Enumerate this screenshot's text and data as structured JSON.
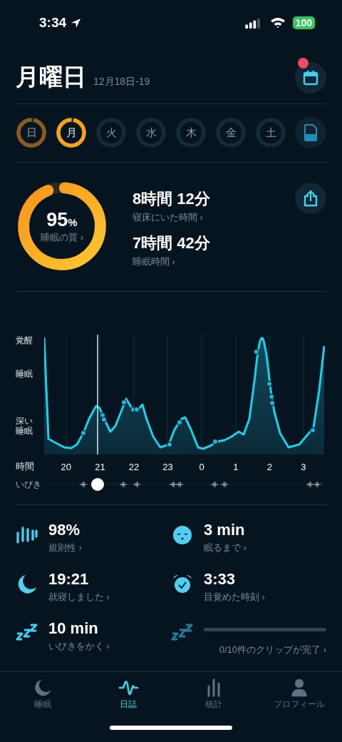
{
  "status_bar": {
    "time": "3:34",
    "battery": "100"
  },
  "header": {
    "title": "月曜日",
    "date": "12月18日-19",
    "notification": true
  },
  "days": [
    {
      "label": "日",
      "kind": "day",
      "level": 0.97,
      "selected": false
    },
    {
      "label": "月",
      "kind": "day",
      "level": 0.97,
      "selected": true
    },
    {
      "label": "火",
      "kind": "day",
      "selected": false
    },
    {
      "label": "水",
      "kind": "day",
      "selected": false
    },
    {
      "label": "木",
      "kind": "day",
      "selected": false
    },
    {
      "label": "金",
      "kind": "day",
      "selected": false
    },
    {
      "label": "土",
      "kind": "day",
      "selected": false
    },
    {
      "kind": "report"
    }
  ],
  "quality": {
    "value": "95",
    "unit": "%",
    "label": "睡眠の質 ›",
    "level": 0.95
  },
  "durations": [
    {
      "value": "8時間 12分",
      "label": "寝床にいた時間 ›"
    },
    {
      "value": "7時間 42分",
      "label": "睡眠時間 ›"
    }
  ],
  "graph": {
    "y_labels": [
      "覚醒",
      "睡眠",
      "深い睡眠"
    ],
    "x_title": "時間",
    "x_labels": [
      "20",
      "21",
      "22",
      "23",
      "0",
      "1",
      "2",
      "3"
    ],
    "snore_label": "いびき"
  },
  "metrics": [
    {
      "kind": "regularity",
      "value": "98%",
      "label": "規則性 ›"
    },
    {
      "kind": "latency",
      "value": "3 min",
      "label": "眠るまで ›"
    },
    {
      "kind": "bedtime",
      "value": "19:21",
      "label": "就寝しました ›"
    },
    {
      "kind": "wake",
      "value": "3:33",
      "label": "目覚めた時刻 ›"
    },
    {
      "kind": "snoring",
      "value": "10 min",
      "label": "いびきをかく ›"
    },
    {
      "kind": "clips",
      "label": "0/10件のクリップが完了 ›"
    }
  ],
  "tabs": [
    {
      "kind": "moon",
      "label": "睡眠",
      "selected": false
    },
    {
      "kind": "wave",
      "label": "日誌",
      "selected": true
    },
    {
      "kind": "bars",
      "label": "統計",
      "selected": false
    },
    {
      "kind": "person",
      "label": "プロフィール",
      "selected": false
    }
  ]
}
